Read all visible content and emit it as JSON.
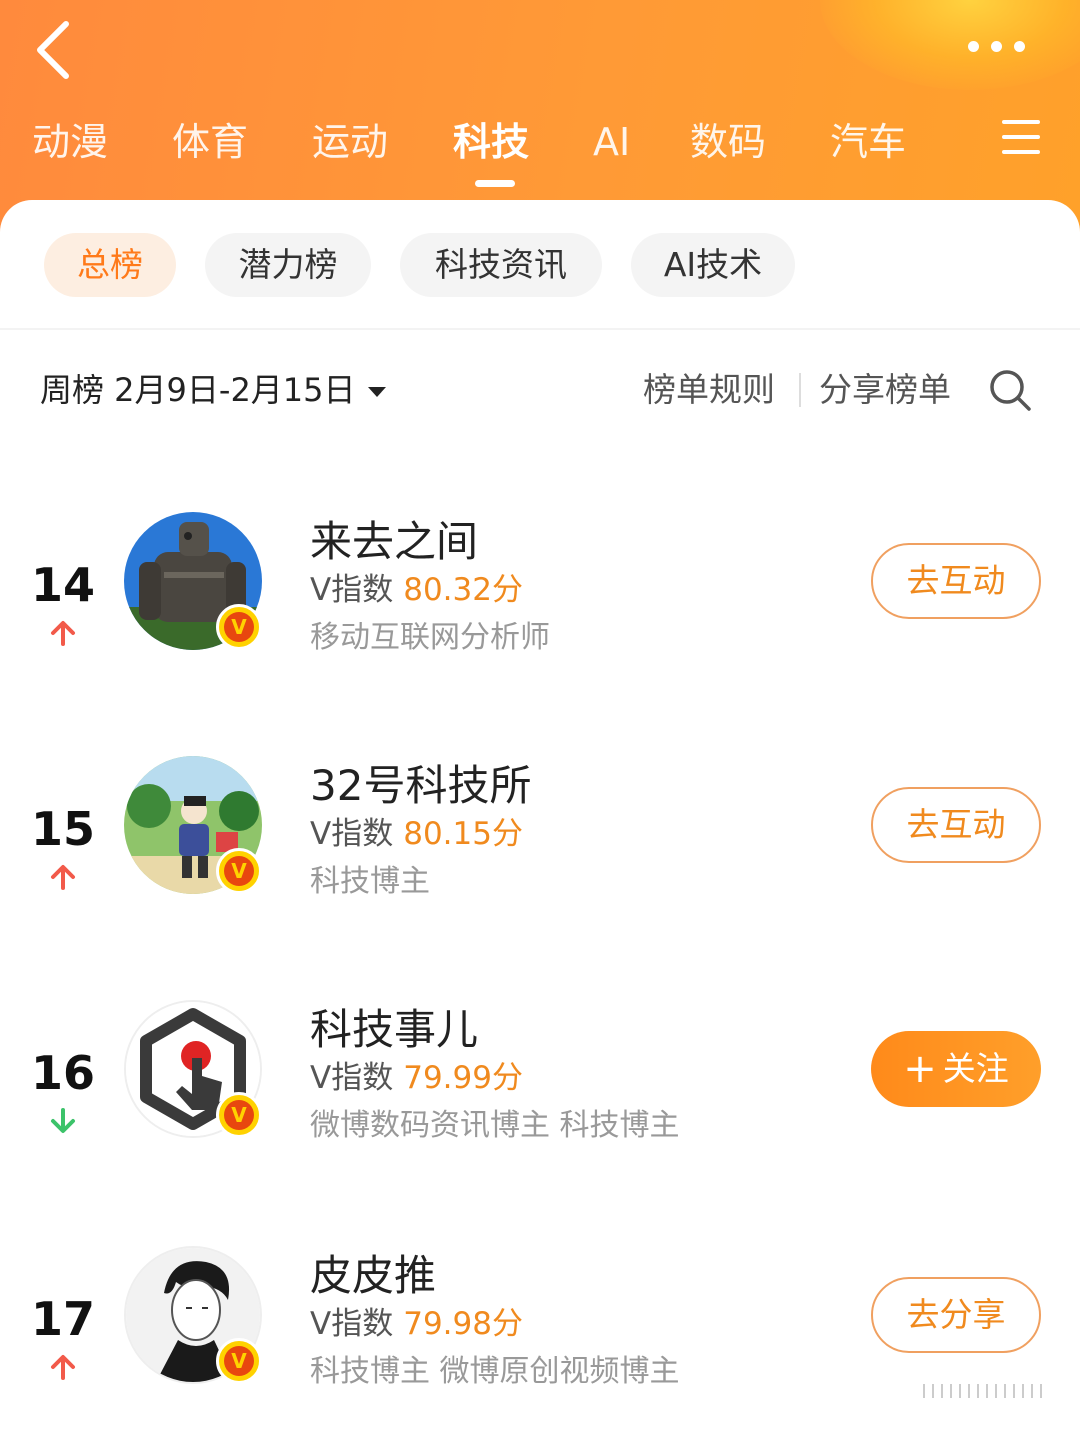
{
  "header": {
    "tabs": [
      {
        "label": "动漫"
      },
      {
        "label": "体育"
      },
      {
        "label": "运动"
      },
      {
        "label": "科技"
      },
      {
        "label": "AI"
      },
      {
        "label": "数码"
      },
      {
        "label": "汽车"
      }
    ],
    "active_tab": "科技",
    "accent_color": "#ff8a3d"
  },
  "filters": {
    "chips": [
      {
        "label": "总榜"
      },
      {
        "label": "潜力榜"
      },
      {
        "label": "科技资讯"
      },
      {
        "label": "AI技术"
      }
    ],
    "active_chip": "总榜"
  },
  "toolbar": {
    "period_label": "周榜 2月9日-2月15日",
    "rules_label": "榜单规则",
    "share_label": "分享榜单"
  },
  "rows": [
    {
      "rank": "14",
      "trend": "up",
      "name": "来去之间",
      "score_label": "V指数",
      "score": "80.32分",
      "desc": "移动互联网分析师",
      "action": "去互动",
      "avatar_icon": "robot-statue-avatar"
    },
    {
      "rank": "15",
      "trend": "up",
      "name": "32号科技所",
      "score_label": "V指数",
      "score": "80.15分",
      "desc": "科技博主",
      "action": "去互动",
      "avatar_icon": "cartoon-boy-avatar"
    },
    {
      "rank": "16",
      "trend": "down",
      "name": "科技事儿",
      "score_label": "V指数",
      "score": "79.99分",
      "desc": "微博数码资讯博主 科技博主",
      "action": "关注",
      "action_prefix": "+",
      "avatar_icon": "hand-tap-logo-avatar"
    },
    {
      "rank": "17",
      "trend": "up",
      "name": "皮皮推",
      "score_label": "V指数",
      "score": "79.98分",
      "desc": "科技博主 微博原创视频博主",
      "action": "去分享",
      "avatar_icon": "sketch-portrait-avatar"
    }
  ],
  "badge": {
    "letter": "V"
  },
  "colors": {
    "score": "#f08a1e",
    "trend_up": "#f25a4a",
    "trend_down": "#3cc36a"
  }
}
